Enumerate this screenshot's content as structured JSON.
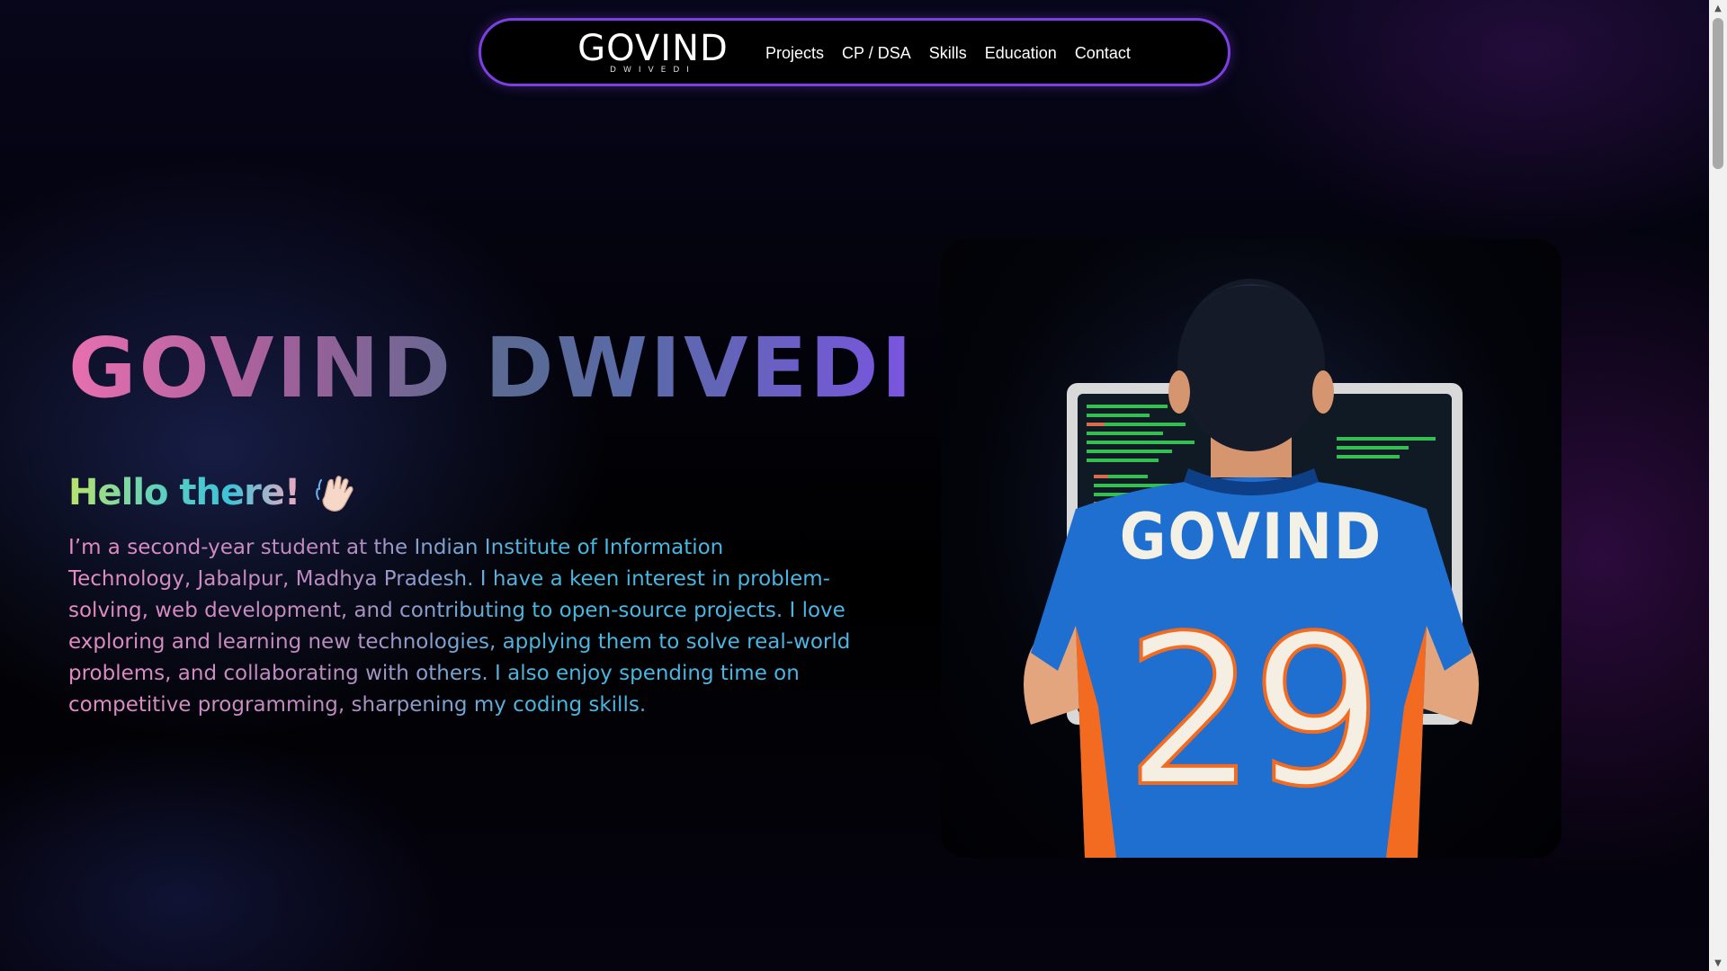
{
  "nav": {
    "logo_main": "GOVIND",
    "logo_sub": "DWIVEDI",
    "links": [
      "Projects",
      "CP / DSA",
      "Skills",
      "Education",
      "Contact"
    ]
  },
  "hero": {
    "title": "GOVIND DWIVEDI",
    "greeting": "Hello there!",
    "greeting_icon": "waving-hand-icon",
    "bio": "I’m a second-year student at the Indian Institute of Information Technology, Jabalpur, Madhya Pradesh. I have a keen interest in problem-solving, web development, and contributing to open-source projects. I love exploring and learning new technologies, applying them to solve real-world problems, and collaborating with others. I also enjoy spending time on competitive programming, sharpening my coding skills."
  },
  "portrait": {
    "jersey_name": "GOVIND",
    "jersey_number": "29"
  },
  "scrollbar": {
    "up_icon": "▲",
    "down_icon": "▼"
  },
  "colors": {
    "nav_border": "#7b3fe4",
    "jersey_blue": "#1f6fd1",
    "jersey_orange": "#f26b21",
    "code_green": "#3ddc5a"
  }
}
